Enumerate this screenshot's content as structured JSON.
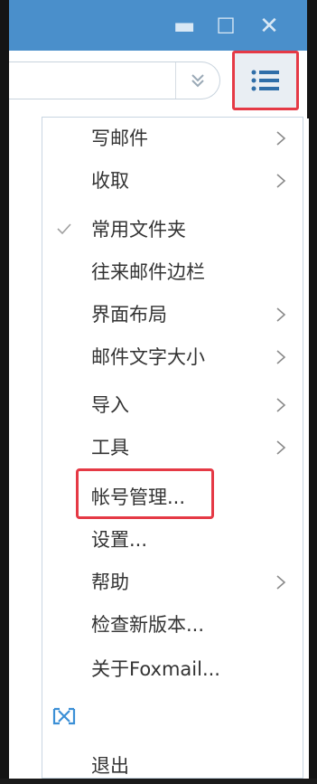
{
  "window": {
    "minimize_icon": "minimize-icon",
    "maximize_icon": "maximize-icon",
    "close_icon": "close-icon",
    "minimize_glyph": "▬",
    "maximize_glyph": "☐",
    "close_glyph": "✕"
  },
  "colors": {
    "titlebar": "#4a8fcb",
    "highlight": "#e53945",
    "menu_text": "#333333",
    "accent": "#3b8fd6"
  },
  "menu": {
    "items": [
      {
        "label": "写邮件",
        "submenu": true,
        "checked": false
      },
      {
        "label": "收取",
        "submenu": true,
        "checked": false
      },
      {
        "label": "常用文件夹",
        "submenu": false,
        "checked": true
      },
      {
        "label": "往来邮件边栏",
        "submenu": false,
        "checked": false
      },
      {
        "label": "界面布局",
        "submenu": true,
        "checked": false
      },
      {
        "label": "邮件文字大小",
        "submenu": true,
        "checked": false
      },
      {
        "label": "导入",
        "submenu": true,
        "checked": false
      },
      {
        "label": "工具",
        "submenu": true,
        "checked": false
      },
      {
        "label": "帐号管理...",
        "submenu": false,
        "checked": false
      },
      {
        "label": "设置...",
        "submenu": false,
        "checked": false
      },
      {
        "label": "帮助",
        "submenu": true,
        "checked": false
      },
      {
        "label": "检查新版本...",
        "submenu": false,
        "checked": false
      },
      {
        "label": "关于Foxmail...",
        "submenu": false,
        "checked": false
      },
      {
        "label": "退出",
        "submenu": false,
        "checked": false
      }
    ],
    "footer_icon": "link-icon"
  }
}
